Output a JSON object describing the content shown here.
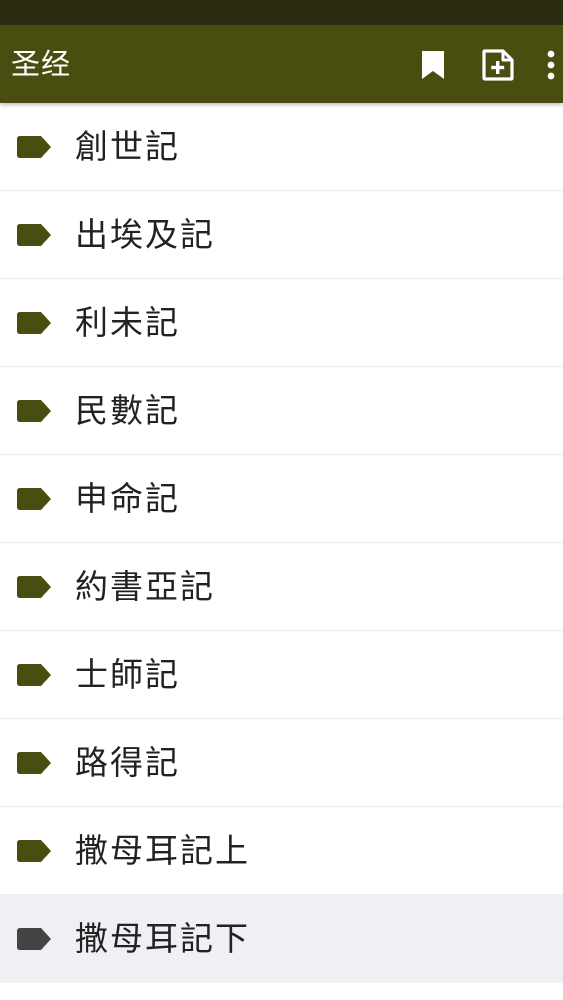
{
  "app_bar": {
    "title": "圣经",
    "icons": {
      "bookmark": "bookmark-icon",
      "add_note": "note-add-icon",
      "more": "more-vert-icon"
    }
  },
  "colors": {
    "status_bar": "#2c2d10",
    "app_bar": "#4a4d10",
    "tag": "#4a4d10",
    "tag_selected": "#444444",
    "selected_row": "#eef0f3"
  },
  "books": {
    "items": [
      {
        "label": "創世記",
        "icon": "tag-icon"
      },
      {
        "label": "出埃及記",
        "icon": "tag-icon"
      },
      {
        "label": "利未記",
        "icon": "tag-icon"
      },
      {
        "label": "民數記",
        "icon": "tag-icon"
      },
      {
        "label": "申命記",
        "icon": "tag-icon"
      },
      {
        "label": "約書亞記",
        "icon": "tag-icon"
      },
      {
        "label": "士師記",
        "icon": "tag-icon"
      },
      {
        "label": "路得記",
        "icon": "tag-icon"
      },
      {
        "label": "撒母耳記上",
        "icon": "tag-icon"
      },
      {
        "label": "撒母耳記下",
        "icon": "tag-icon",
        "selected": true
      }
    ]
  }
}
